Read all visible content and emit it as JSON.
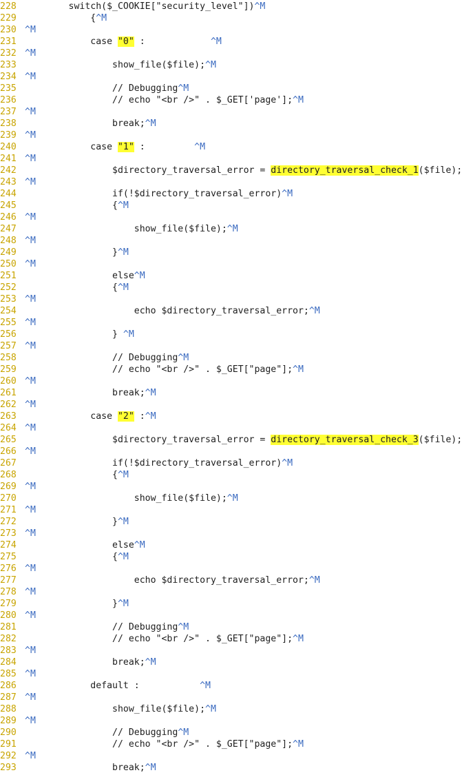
{
  "editor": {
    "highlight_color": "#ffff33",
    "line_number_color": "#c8a400",
    "control_char_color": "#3a6ac0",
    "lines": [
      {
        "num": "228",
        "segs": [
          {
            "t": "        switch($_COOKIE[\"security_level\"])"
          },
          {
            "t": "^M",
            "c": "cr"
          }
        ]
      },
      {
        "num": "229",
        "segs": [
          {
            "t": "            {"
          },
          {
            "t": "^M",
            "c": "cr"
          }
        ]
      },
      {
        "num": "230",
        "segs": [
          {
            "t": "^M",
            "c": "cr"
          }
        ]
      },
      {
        "num": "231",
        "segs": [
          {
            "t": "            case "
          },
          {
            "t": "\"0\"",
            "c": "hl"
          },
          {
            "t": " :            "
          },
          {
            "t": "^M",
            "c": "cr"
          }
        ]
      },
      {
        "num": "232",
        "segs": [
          {
            "t": "^M",
            "c": "cr"
          }
        ]
      },
      {
        "num": "233",
        "segs": [
          {
            "t": "                show_file($file);"
          },
          {
            "t": "^M",
            "c": "cr"
          }
        ]
      },
      {
        "num": "234",
        "segs": [
          {
            "t": "^M",
            "c": "cr"
          }
        ]
      },
      {
        "num": "235",
        "segs": [
          {
            "t": "                // Debugging"
          },
          {
            "t": "^M",
            "c": "cr"
          }
        ]
      },
      {
        "num": "236",
        "segs": [
          {
            "t": "                // echo \"<br />\" . $_GET['page'];"
          },
          {
            "t": "^M",
            "c": "cr"
          }
        ]
      },
      {
        "num": "237",
        "segs": [
          {
            "t": "^M",
            "c": "cr"
          }
        ]
      },
      {
        "num": "238",
        "segs": [
          {
            "t": "                break;"
          },
          {
            "t": "^M",
            "c": "cr"
          }
        ]
      },
      {
        "num": "239",
        "segs": [
          {
            "t": "^M",
            "c": "cr"
          }
        ]
      },
      {
        "num": "240",
        "segs": [
          {
            "t": "            case "
          },
          {
            "t": "\"1\"",
            "c": "hl"
          },
          {
            "t": " :         "
          },
          {
            "t": "^M",
            "c": "cr"
          }
        ]
      },
      {
        "num": "241",
        "segs": [
          {
            "t": "^M",
            "c": "cr"
          }
        ]
      },
      {
        "num": "242",
        "segs": [
          {
            "t": "                $directory_traversal_error = "
          },
          {
            "t": "directory_traversal_check_1",
            "c": "hl"
          },
          {
            "t": "($file);"
          }
        ]
      },
      {
        "num": "243",
        "segs": [
          {
            "t": "^M",
            "c": "cr"
          }
        ]
      },
      {
        "num": "244",
        "segs": [
          {
            "t": "                if(!$directory_traversal_error)"
          },
          {
            "t": "^M",
            "c": "cr"
          }
        ]
      },
      {
        "num": "245",
        "segs": [
          {
            "t": "                {"
          },
          {
            "t": "^M",
            "c": "cr"
          }
        ]
      },
      {
        "num": "246",
        "segs": [
          {
            "t": "^M",
            "c": "cr"
          }
        ]
      },
      {
        "num": "247",
        "segs": [
          {
            "t": "                    show_file($file);"
          },
          {
            "t": "^M",
            "c": "cr"
          }
        ]
      },
      {
        "num": "248",
        "segs": [
          {
            "t": "^M",
            "c": "cr"
          }
        ]
      },
      {
        "num": "249",
        "segs": [
          {
            "t": "                }"
          },
          {
            "t": "^M",
            "c": "cr"
          }
        ]
      },
      {
        "num": "250",
        "segs": [
          {
            "t": "^M",
            "c": "cr"
          }
        ]
      },
      {
        "num": "251",
        "segs": [
          {
            "t": "                else"
          },
          {
            "t": "^M",
            "c": "cr"
          }
        ]
      },
      {
        "num": "252",
        "segs": [
          {
            "t": "                {"
          },
          {
            "t": "^M",
            "c": "cr"
          }
        ]
      },
      {
        "num": "253",
        "segs": [
          {
            "t": "^M",
            "c": "cr"
          }
        ]
      },
      {
        "num": "254",
        "segs": [
          {
            "t": "                    echo $directory_traversal_error;"
          },
          {
            "t": "^M",
            "c": "cr"
          }
        ]
      },
      {
        "num": "255",
        "segs": [
          {
            "t": "^M",
            "c": "cr"
          }
        ]
      },
      {
        "num": "256",
        "segs": [
          {
            "t": "                } "
          },
          {
            "t": "^M",
            "c": "cr"
          }
        ]
      },
      {
        "num": "257",
        "segs": [
          {
            "t": "^M",
            "c": "cr"
          }
        ]
      },
      {
        "num": "258",
        "segs": [
          {
            "t": "                // Debugging"
          },
          {
            "t": "^M",
            "c": "cr"
          }
        ]
      },
      {
        "num": "259",
        "segs": [
          {
            "t": "                // echo \"<br />\" . $_GET[\"page\"];"
          },
          {
            "t": "^M",
            "c": "cr"
          }
        ]
      },
      {
        "num": "260",
        "segs": [
          {
            "t": "^M",
            "c": "cr"
          }
        ]
      },
      {
        "num": "261",
        "segs": [
          {
            "t": "                break;"
          },
          {
            "t": "^M",
            "c": "cr"
          }
        ]
      },
      {
        "num": "262",
        "segs": [
          {
            "t": "^M",
            "c": "cr"
          }
        ]
      },
      {
        "num": "263",
        "segs": [
          {
            "t": "            case "
          },
          {
            "t": "\"2\"",
            "c": "hl"
          },
          {
            "t": " :"
          },
          {
            "t": "^M",
            "c": "cr"
          }
        ]
      },
      {
        "num": "264",
        "segs": [
          {
            "t": "^M",
            "c": "cr"
          }
        ]
      },
      {
        "num": "265",
        "segs": [
          {
            "t": "                $directory_traversal_error = "
          },
          {
            "t": "directory_traversal_check_3",
            "c": "hl"
          },
          {
            "t": "($file);"
          }
        ]
      },
      {
        "num": "266",
        "segs": [
          {
            "t": "^M",
            "c": "cr"
          }
        ]
      },
      {
        "num": "267",
        "segs": [
          {
            "t": "                if(!$directory_traversal_error)"
          },
          {
            "t": "^M",
            "c": "cr"
          }
        ]
      },
      {
        "num": "268",
        "segs": [
          {
            "t": "                {"
          },
          {
            "t": "^M",
            "c": "cr"
          }
        ]
      },
      {
        "num": "269",
        "segs": [
          {
            "t": "^M",
            "c": "cr"
          }
        ]
      },
      {
        "num": "270",
        "segs": [
          {
            "t": "                    show_file($file);"
          },
          {
            "t": "^M",
            "c": "cr"
          }
        ]
      },
      {
        "num": "271",
        "segs": [
          {
            "t": "^M",
            "c": "cr"
          }
        ]
      },
      {
        "num": "272",
        "segs": [
          {
            "t": "                }"
          },
          {
            "t": "^M",
            "c": "cr"
          }
        ]
      },
      {
        "num": "273",
        "segs": [
          {
            "t": "^M",
            "c": "cr"
          }
        ]
      },
      {
        "num": "274",
        "segs": [
          {
            "t": "                else"
          },
          {
            "t": "^M",
            "c": "cr"
          }
        ]
      },
      {
        "num": "275",
        "segs": [
          {
            "t": "                {"
          },
          {
            "t": "^M",
            "c": "cr"
          }
        ]
      },
      {
        "num": "276",
        "segs": [
          {
            "t": "^M",
            "c": "cr"
          }
        ]
      },
      {
        "num": "277",
        "segs": [
          {
            "t": "                    echo $directory_traversal_error;"
          },
          {
            "t": "^M",
            "c": "cr"
          }
        ]
      },
      {
        "num": "278",
        "segs": [
          {
            "t": "^M",
            "c": "cr"
          }
        ]
      },
      {
        "num": "279",
        "segs": [
          {
            "t": "                }"
          },
          {
            "t": "^M",
            "c": "cr"
          }
        ]
      },
      {
        "num": "280",
        "segs": [
          {
            "t": "^M",
            "c": "cr"
          }
        ]
      },
      {
        "num": "281",
        "segs": [
          {
            "t": "                // Debugging"
          },
          {
            "t": "^M",
            "c": "cr"
          }
        ]
      },
      {
        "num": "282",
        "segs": [
          {
            "t": "                // echo \"<br />\" . $_GET[\"page\"];"
          },
          {
            "t": "^M",
            "c": "cr"
          }
        ]
      },
      {
        "num": "283",
        "segs": [
          {
            "t": "^M",
            "c": "cr"
          }
        ]
      },
      {
        "num": "284",
        "segs": [
          {
            "t": "                break;"
          },
          {
            "t": "^M",
            "c": "cr"
          }
        ]
      },
      {
        "num": "285",
        "segs": [
          {
            "t": "^M",
            "c": "cr"
          }
        ]
      },
      {
        "num": "286",
        "segs": [
          {
            "t": "            default :           "
          },
          {
            "t": "^M",
            "c": "cr"
          }
        ]
      },
      {
        "num": "287",
        "segs": [
          {
            "t": "^M",
            "c": "cr"
          }
        ]
      },
      {
        "num": "288",
        "segs": [
          {
            "t": "                show_file($file);"
          },
          {
            "t": "^M",
            "c": "cr"
          }
        ]
      },
      {
        "num": "289",
        "segs": [
          {
            "t": "^M",
            "c": "cr"
          }
        ]
      },
      {
        "num": "290",
        "segs": [
          {
            "t": "                // Debugging"
          },
          {
            "t": "^M",
            "c": "cr"
          }
        ]
      },
      {
        "num": "291",
        "segs": [
          {
            "t": "                // echo \"<br />\" . $_GET[\"page\"];"
          },
          {
            "t": "^M",
            "c": "cr"
          }
        ]
      },
      {
        "num": "292",
        "segs": [
          {
            "t": "^M",
            "c": "cr"
          }
        ]
      },
      {
        "num": "293",
        "segs": [
          {
            "t": "                break;"
          },
          {
            "t": "^M",
            "c": "cr"
          }
        ]
      }
    ]
  }
}
